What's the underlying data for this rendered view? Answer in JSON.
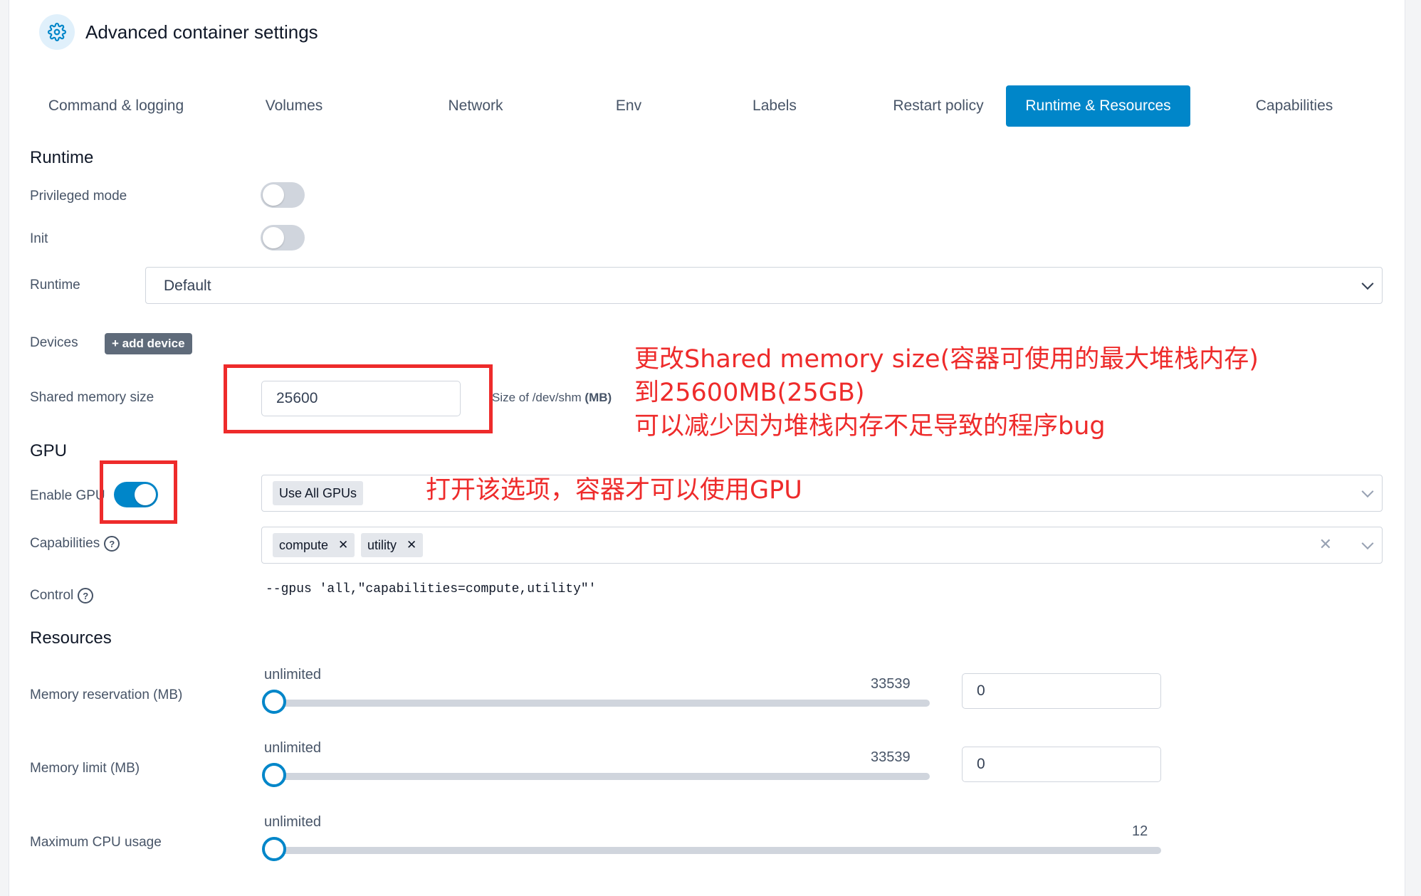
{
  "header": {
    "title": "Advanced container settings",
    "icon": "gear-icon"
  },
  "tabs": [
    {
      "label": "Command & logging"
    },
    {
      "label": "Volumes"
    },
    {
      "label": "Network"
    },
    {
      "label": "Env"
    },
    {
      "label": "Labels"
    },
    {
      "label": "Restart policy"
    },
    {
      "label": "Runtime & Resources",
      "active": true
    },
    {
      "label": "Capabilities"
    }
  ],
  "runtime": {
    "heading": "Runtime",
    "privileged_label": "Privileged mode",
    "privileged": false,
    "init_label": "Init",
    "init": false,
    "runtime_label": "Runtime",
    "runtime_value": "Default",
    "devices_label": "Devices",
    "add_device": "+ add device",
    "shm_label": "Shared memory size",
    "shm_value": "25600",
    "shm_hint": "Size of /dev/shm",
    "shm_unit": "(MB)"
  },
  "gpu": {
    "heading": "GPU",
    "enable_label": "Enable GPU",
    "enabled": true,
    "gpu_chip": "Use All GPUs",
    "capabilities_label": "Capabilities",
    "capabilities": [
      "compute",
      "utility"
    ],
    "control_label": "Control",
    "control_value": "--gpus 'all,\"capabilities=compute,utility\"'"
  },
  "resources": {
    "heading": "Resources",
    "memory_reservation": {
      "label": "Memory reservation (MB)",
      "min_label": "unlimited",
      "max_label": "33539",
      "value": "0"
    },
    "memory_limit": {
      "label": "Memory limit (MB)",
      "min_label": "unlimited",
      "max_label": "33539",
      "value": "0"
    },
    "max_cpu": {
      "label": "Maximum CPU usage",
      "min_label": "unlimited",
      "max_label": "12"
    }
  },
  "annotations": {
    "shm_note": [
      "更改Shared memory size(容器可使用的最大堆栈内存)",
      "到25600MB(25GB)",
      "可以减少因为堆栈内存不足导致的程序bug"
    ],
    "gpu_note": "打开该选项，容器才可以使用GPU"
  },
  "colors": {
    "accent": "#0086c9",
    "annotation": "#ee2b2b"
  }
}
